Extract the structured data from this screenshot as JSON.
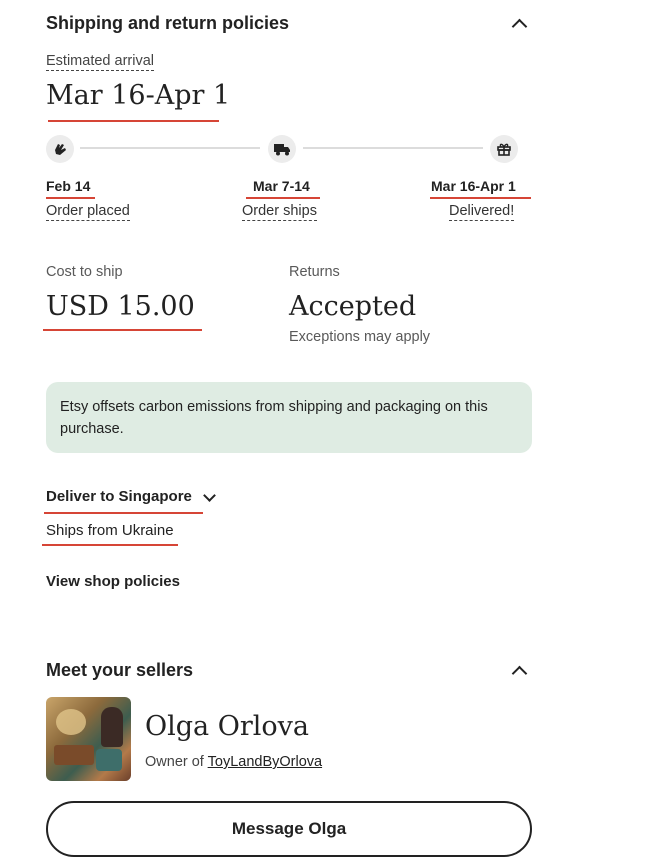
{
  "shipping": {
    "title": "Shipping and return policies",
    "estimated_label": "Estimated arrival",
    "estimated_value": "Mar 16-Apr 1",
    "steps": [
      {
        "date": "Feb 14",
        "label": "Order placed",
        "icon": "hand-icon"
      },
      {
        "date": "Mar 7-14",
        "label": "Order ships",
        "icon": "truck-icon"
      },
      {
        "date": "Mar 16-Apr 1",
        "label": "Delivered!",
        "icon": "gift-icon"
      }
    ],
    "cost_label": "Cost to ship",
    "cost_value": "USD 15.00",
    "returns_label": "Returns",
    "returns_value": "Accepted",
    "returns_note": "Exceptions may apply",
    "carbon_note": "Etsy offsets carbon emissions from shipping and packaging on this purchase.",
    "deliver_to": "Deliver to Singapore",
    "ships_from": "Ships from Ukraine",
    "view_policies": "View shop policies"
  },
  "sellers": {
    "title": "Meet your sellers",
    "name": "Olga Orlova",
    "owner_prefix": "Owner of",
    "shop_name": "ToyLandByOrlova",
    "message_button": "Message Olga"
  },
  "colors": {
    "annotation_red": "#d64536",
    "carbon_bg": "#dfece3"
  }
}
